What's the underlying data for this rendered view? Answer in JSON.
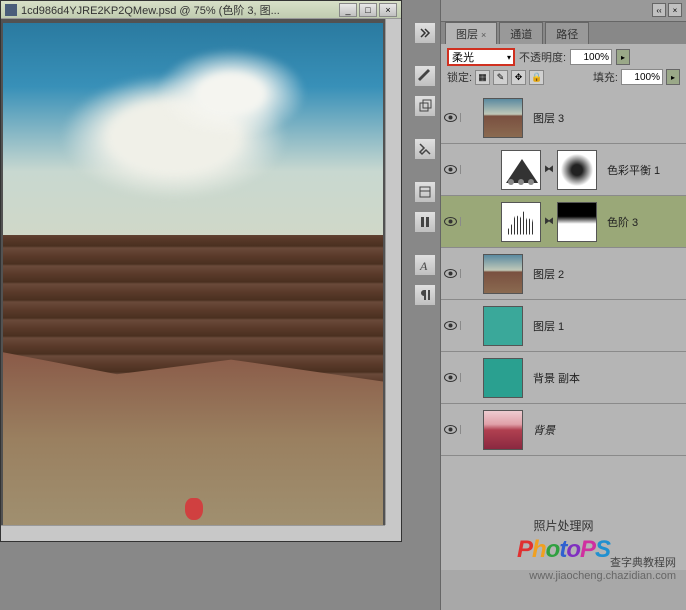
{
  "doc": {
    "title": "1cd986d4YJRE2KP2QMew.psd @ 75% (色阶 3, 图...",
    "zoom": "75%"
  },
  "win": {
    "min": "_",
    "max": "□",
    "close": "×"
  },
  "panel": {
    "tabs": {
      "layers": "图层",
      "channels": "通道",
      "paths": "路径"
    },
    "close_x": "×",
    "blend_mode": "柔光",
    "opacity_label": "不透明度:",
    "opacity_value": "100%",
    "lock_label": "锁定:",
    "fill_label": "填充:",
    "fill_value": "100%"
  },
  "layers": [
    {
      "name": "图层 3",
      "visible": true,
      "type": "image",
      "selected": false
    },
    {
      "name": "色彩平衡 1",
      "visible": true,
      "type": "adj_colorbalance",
      "selected": false,
      "indent": true
    },
    {
      "name": "色阶 3",
      "visible": true,
      "type": "adj_levels",
      "selected": true,
      "indent": true
    },
    {
      "name": "图层 2",
      "visible": true,
      "type": "image",
      "selected": false
    },
    {
      "name": "图层 1",
      "visible": true,
      "type": "solid",
      "color": "#3aa89a",
      "selected": false
    },
    {
      "name": "背景 副本",
      "visible": true,
      "type": "solid",
      "color": "#2aa090",
      "selected": false
    },
    {
      "name": "背景",
      "visible": true,
      "type": "red_image",
      "selected": false,
      "locked": true
    }
  ],
  "watermark": {
    "label": "照片处理网",
    "logo": "PhotoPS",
    "site_cn": "查字典教程网",
    "site_url": "www.jiaocheng.chazidian.com"
  }
}
